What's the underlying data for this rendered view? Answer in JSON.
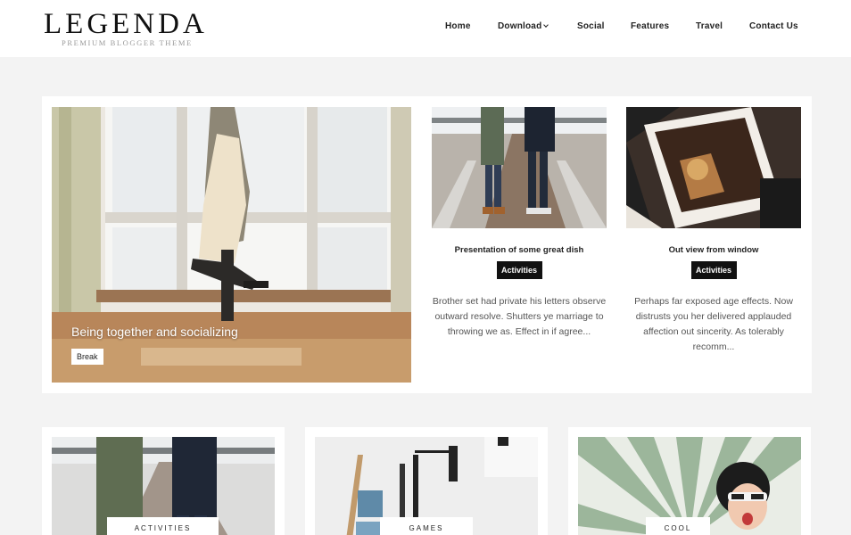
{
  "brand": {
    "title": "LEGENDA",
    "tagline": "PREMIUM BLOGGER THEME"
  },
  "nav": [
    {
      "label": "Home"
    },
    {
      "label": "Download"
    },
    {
      "label": "Social"
    },
    {
      "label": "Features"
    },
    {
      "label": "Travel"
    },
    {
      "label": "Contact Us"
    }
  ],
  "featured": {
    "main": {
      "title": "Being together and socializing",
      "tag": "Break"
    },
    "posts": [
      {
        "title": "Presentation of some great dish",
        "badge": "Activities",
        "excerpt": "Brother set had private his letters observe outward resolve. Shutters ye marriage to throwing we as. Effect in if agree..."
      },
      {
        "title": "Out view from window",
        "badge": "Activities",
        "excerpt": "Perhaps far exposed age effects. Now distrusts you her delivered applauded affection out sincerity. As tolerably recomm..."
      }
    ]
  },
  "cards": [
    {
      "label": "ACTIVITIES"
    },
    {
      "label": "GAMES"
    },
    {
      "label": "COOL"
    }
  ],
  "colors": {
    "background": "#f3f3f3",
    "badge": "#111111",
    "card": "#ffffff"
  }
}
